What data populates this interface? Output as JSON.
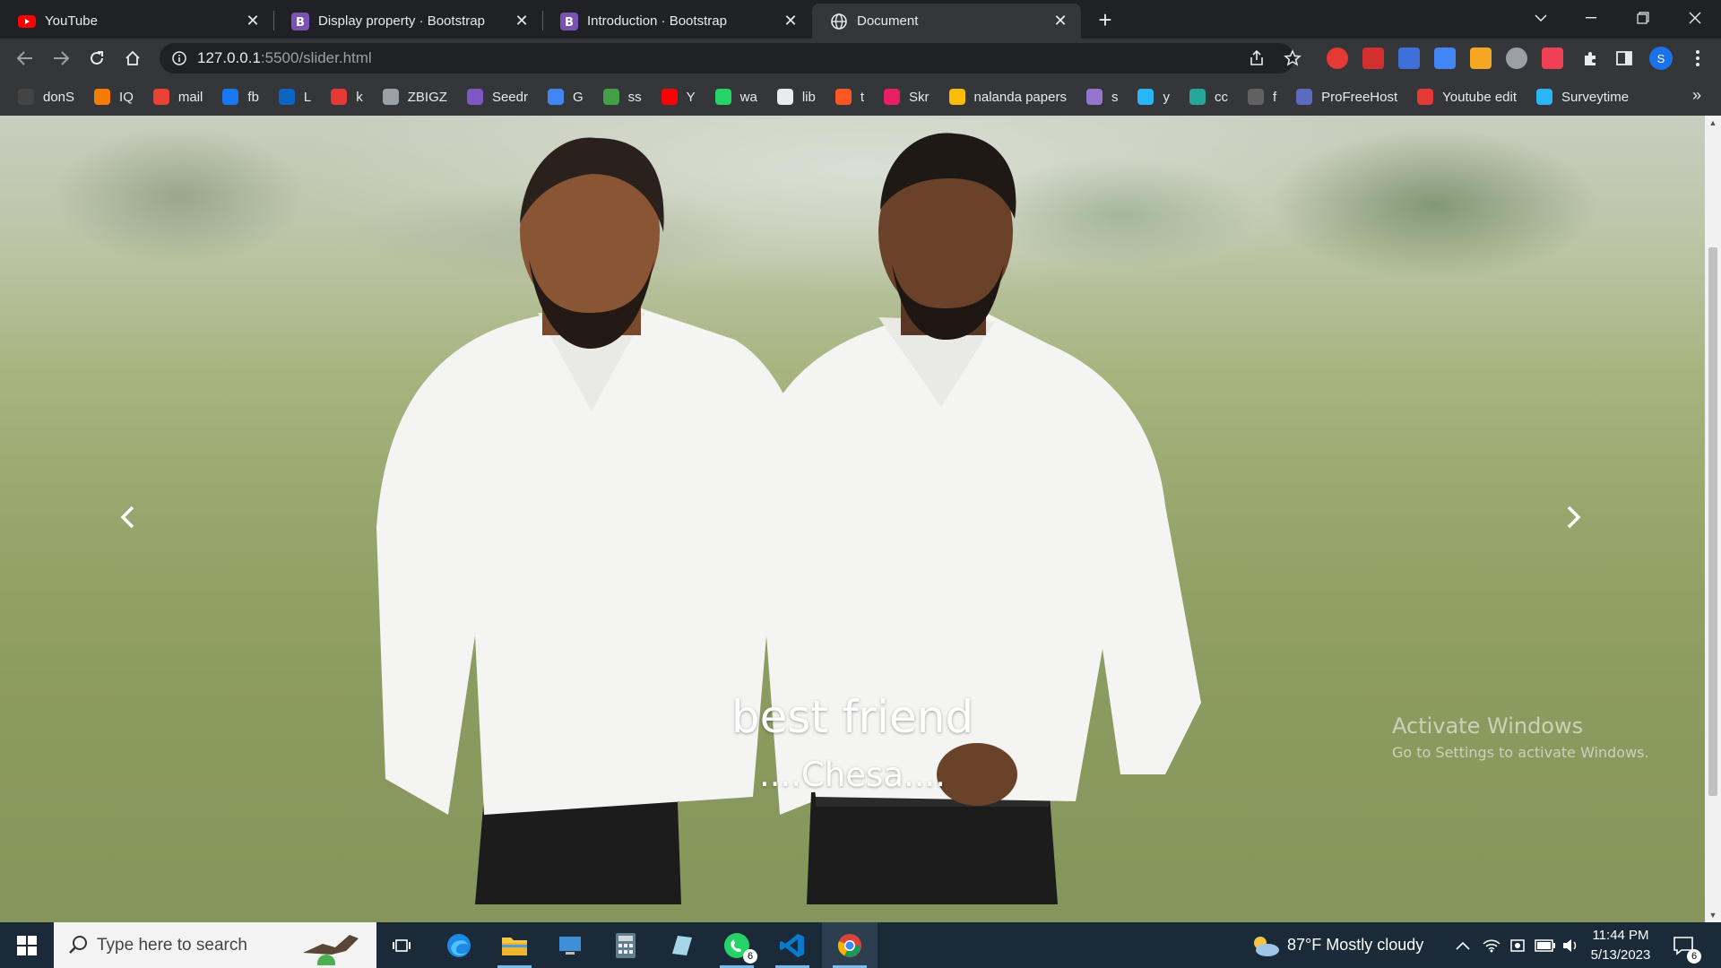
{
  "tabs": [
    {
      "title": "YouTube",
      "icon": "youtube-icon"
    },
    {
      "title": "Display property · Bootstrap",
      "icon": "bootstrap-icon"
    },
    {
      "title": "Introduction · Bootstrap",
      "icon": "bootstrap-icon"
    },
    {
      "title": "Document",
      "icon": "globe-icon",
      "active": true
    }
  ],
  "address": {
    "host": "127.0.0.1",
    "path": ":5500/slider.html"
  },
  "bookmarks": [
    {
      "label": "donS",
      "icon": "bookmark-icon",
      "color": "#444444"
    },
    {
      "label": "IQ",
      "icon": "chart-icon",
      "color": "#f57c00"
    },
    {
      "label": "mail",
      "icon": "gmail-icon",
      "color": "#ea4335"
    },
    {
      "label": "fb",
      "icon": "facebook-icon",
      "color": "#1877f2"
    },
    {
      "label": "L",
      "icon": "linkedin-icon",
      "color": "#0a66c2"
    },
    {
      "label": "k",
      "icon": "apps-icon",
      "color": "#e53935"
    },
    {
      "label": "ZBIGZ",
      "icon": "cloud-icon",
      "color": "#9aa0a6"
    },
    {
      "label": "Seedr",
      "icon": "seed-icon",
      "color": "#7e57c2"
    },
    {
      "label": "G",
      "icon": "translate-icon",
      "color": "#4285f4"
    },
    {
      "label": "ss",
      "icon": "download-icon",
      "color": "#43a047"
    },
    {
      "label": "Y",
      "icon": "youtube-icon",
      "color": "#ff0000"
    },
    {
      "label": "wa",
      "icon": "whatsapp-icon",
      "color": "#25d366"
    },
    {
      "label": "lib",
      "icon": "book-icon",
      "color": "#e8eaed"
    },
    {
      "label": "t",
      "icon": "x-icon",
      "color": "#ff5722"
    },
    {
      "label": "Skr",
      "icon": "s-icon",
      "color": "#e91e63"
    },
    {
      "label": "nalanda papers",
      "icon": "drive-icon",
      "color": "#fbbc04"
    },
    {
      "label": "s",
      "icon": "drop-icon",
      "color": "#9575cd"
    },
    {
      "label": "y",
      "icon": "drop-blue-icon",
      "color": "#29b6f6"
    },
    {
      "label": "cc",
      "icon": "trend-icon",
      "color": "#26a69a"
    },
    {
      "label": "f",
      "icon": "mask-icon",
      "color": "#616161"
    },
    {
      "label": "ProFreeHost",
      "icon": "feather-icon",
      "color": "#5c6bc0"
    },
    {
      "label": "Youtube edit",
      "icon": "flag-icon",
      "color": "#e53935"
    },
    {
      "label": "Surveytime",
      "icon": "check-icon",
      "color": "#29b6f6"
    }
  ],
  "profile_initial": "S",
  "slide": {
    "title": "best friend",
    "subtitle": "....Chesa...."
  },
  "watermark": {
    "line1": "Activate Windows",
    "line2": "Go to Settings to activate Windows."
  },
  "taskbar": {
    "search_placeholder": "Type here to search",
    "whatsapp_badge": "6",
    "weather": "87°F  Mostly cloudy",
    "time": "11:44 PM",
    "date": "5/13/2023",
    "notifications": "6"
  }
}
